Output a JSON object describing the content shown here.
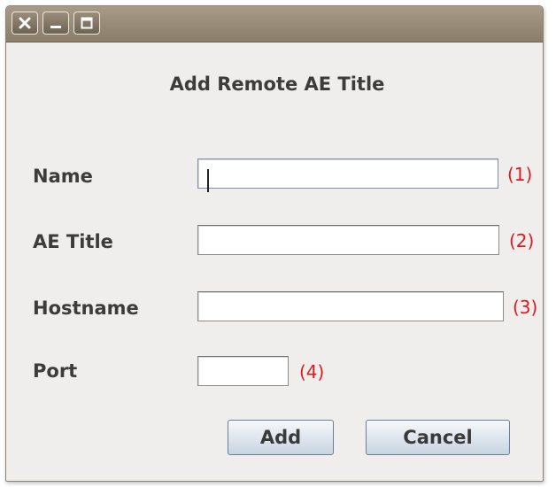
{
  "window": {
    "controls": [
      "close-icon",
      "minimize-icon",
      "maximize-icon"
    ]
  },
  "dialog": {
    "title": "Add Remote AE Title"
  },
  "form": {
    "name": {
      "label": "Name",
      "value": "",
      "marker": "(1)"
    },
    "ae_title": {
      "label": "AE Title",
      "value": "",
      "marker": "(2)"
    },
    "hostname": {
      "label": "Hostname",
      "value": "",
      "marker": "(3)"
    },
    "port": {
      "label": "Port",
      "value": "",
      "marker": "(4)"
    }
  },
  "buttons": {
    "add_label": "Add",
    "cancel_label": "Cancel"
  },
  "colors": {
    "marker": "#e0191a",
    "titlebar": "#8a7e6a",
    "background": "#efeeed"
  }
}
